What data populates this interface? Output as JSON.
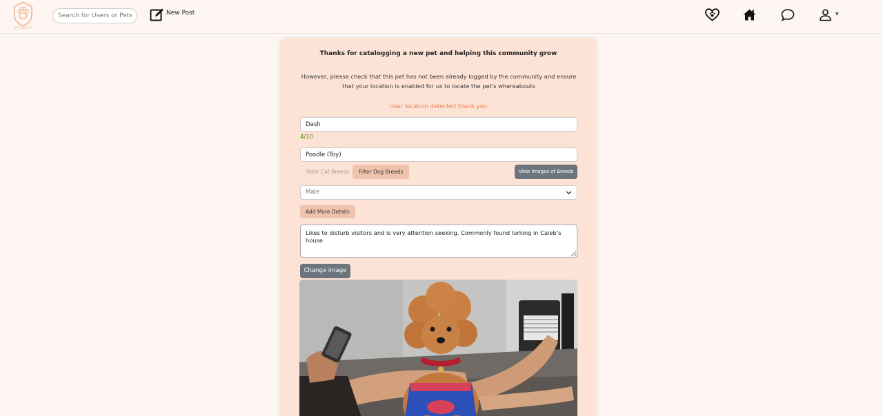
{
  "navbar": {
    "logo_text": "PET SOCIETY",
    "search_placeholder": "Search for Users or Pets",
    "new_post_label": "New Post",
    "icons": [
      "heart-paw-icon",
      "home-icon",
      "chat-icon",
      "user-icon"
    ]
  },
  "form": {
    "heading": "Thanks for catalogging a new pet and helping this community grow",
    "info": "However, please check that this pet has not been already logged by the community and ensure that your location is enabled for us to locate the pet's whereabouts",
    "location_status": "User location detected thank you",
    "name_value": "Dash",
    "name_counter": "4/10",
    "breed_value": "Poodle (Toy)",
    "filter_cat_label": "Filter Cat Breeds",
    "filter_dog_label": "Filter Dog Breeds",
    "view_images_label": "View Images of Breeds",
    "gender_selected": "Male",
    "add_details_label": "Add More Details",
    "description_value": "Likes to disturb visitors and is very attention seeking. Commonly found lurking in Caleb's house",
    "change_image_label": "Change image"
  },
  "colors": {
    "background": "#fdf6f3",
    "card": "#fde3d6",
    "accent": "#e8824f",
    "secondary_button": "#6c757d",
    "pill_button": "#f0c3ac",
    "counter": "#5a8a1f"
  }
}
